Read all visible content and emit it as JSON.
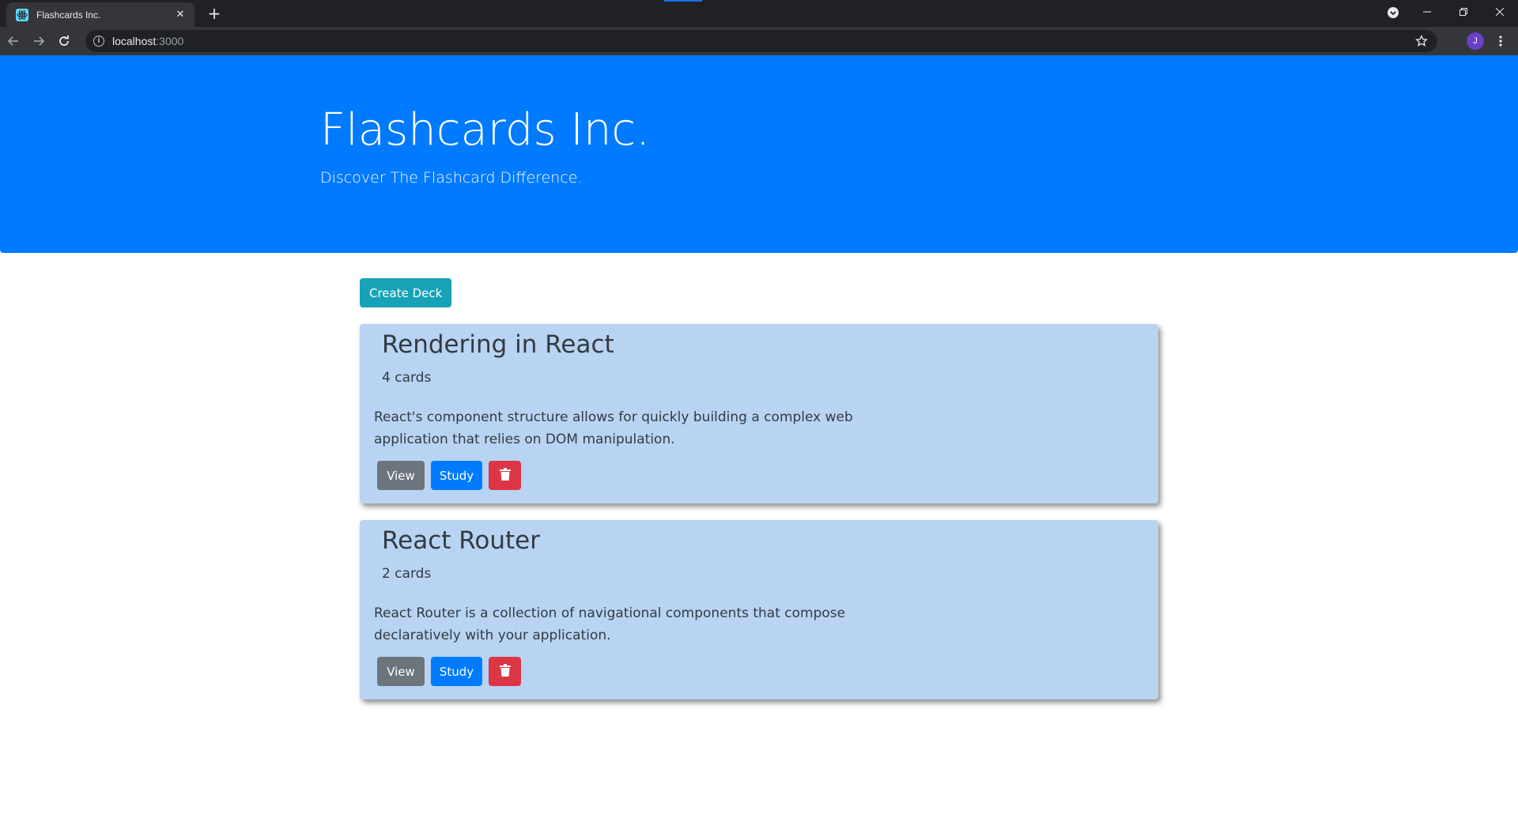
{
  "browser": {
    "tab_title": "Flashcards Inc.",
    "tab_close": "✕",
    "new_tab": "+",
    "url_host": "localhost",
    "url_port": ":3000",
    "avatar_initial": "J",
    "info_glyph": "i"
  },
  "header": {
    "title": "Flashcards Inc.",
    "subtitle": "Discover The Flashcard Difference."
  },
  "actions": {
    "create_deck_label": "Create Deck"
  },
  "decks": [
    {
      "name": "Rendering in React",
      "count": "4 cards",
      "description": "React's component structure allows for quickly building a complex web application that relies on DOM manipulation.",
      "view_label": "View",
      "study_label": "Study"
    },
    {
      "name": "React Router",
      "count": "2 cards",
      "description": "React Router is a collection of navigational components that compose declaratively with your application.",
      "view_label": "View",
      "study_label": "Study"
    }
  ],
  "colors": {
    "primary": "#007bff",
    "info": "#17a2b8",
    "secondary": "#6c757d",
    "danger": "#dc3545",
    "card_bg": "#b8d4f2"
  },
  "icons": {
    "favicon": "react-logo-icon",
    "delete": "trash-icon"
  }
}
